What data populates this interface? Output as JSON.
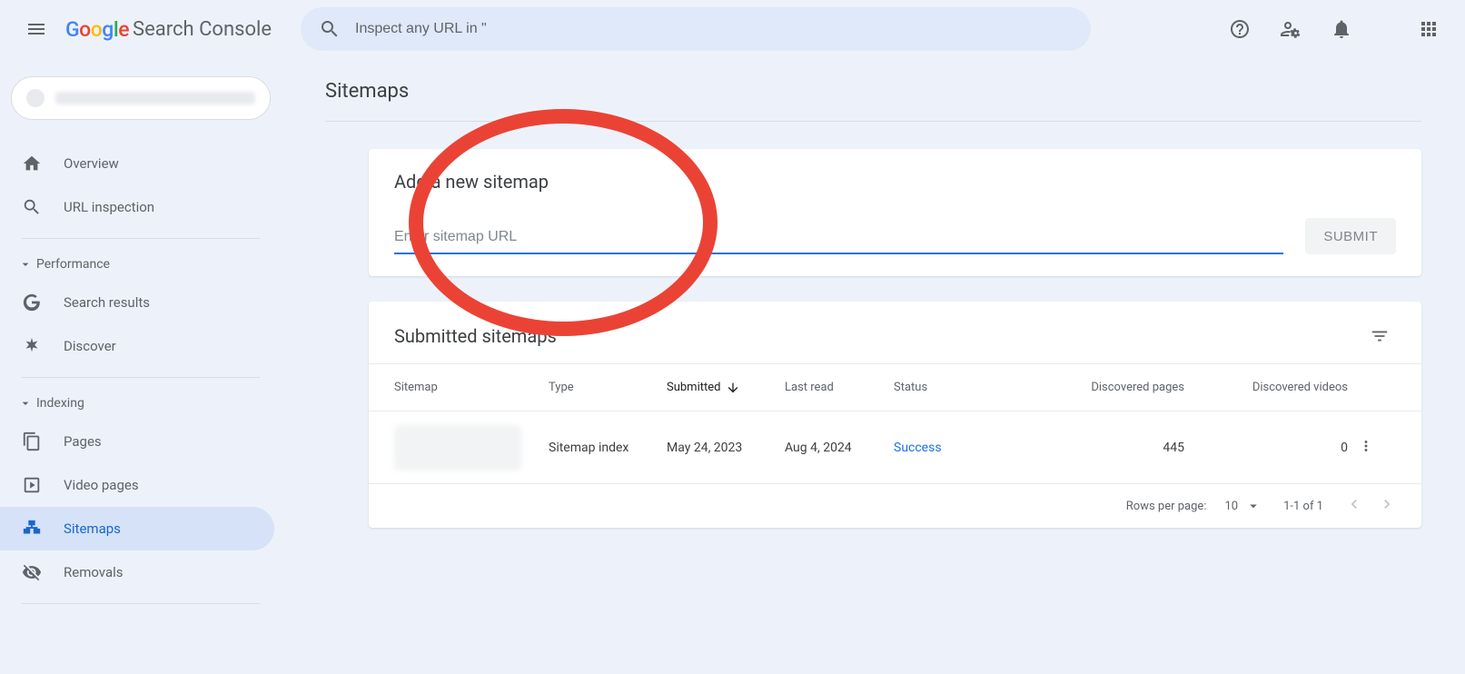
{
  "header": {
    "brand_text": "Search Console",
    "search_placeholder": "Inspect any URL in \""
  },
  "sidebar": {
    "overview": "Overview",
    "url_inspection": "URL inspection",
    "section_performance": "Performance",
    "search_results": "Search results",
    "discover": "Discover",
    "section_indexing": "Indexing",
    "pages": "Pages",
    "video_pages": "Video pages",
    "sitemaps": "Sitemaps",
    "removals": "Removals"
  },
  "page": {
    "title": "Sitemaps",
    "add_card_title": "Add a new sitemap",
    "sitemap_placeholder": "Enter sitemap URL",
    "submit_label": "SUBMIT",
    "table_title": "Submitted sitemaps",
    "cols": {
      "sitemap": "Sitemap",
      "type": "Type",
      "submitted": "Submitted",
      "last_read": "Last read",
      "status": "Status",
      "disc_pages": "Discovered pages",
      "disc_videos": "Discovered videos"
    },
    "row": {
      "type": "Sitemap index",
      "submitted": "May 24, 2023",
      "last_read": "Aug 4, 2024",
      "status": "Success",
      "disc_pages": "445",
      "disc_videos": "0"
    },
    "footer": {
      "rpp_label": "Rows per page:",
      "rpp_value": "10",
      "range": "1-1 of 1"
    }
  }
}
